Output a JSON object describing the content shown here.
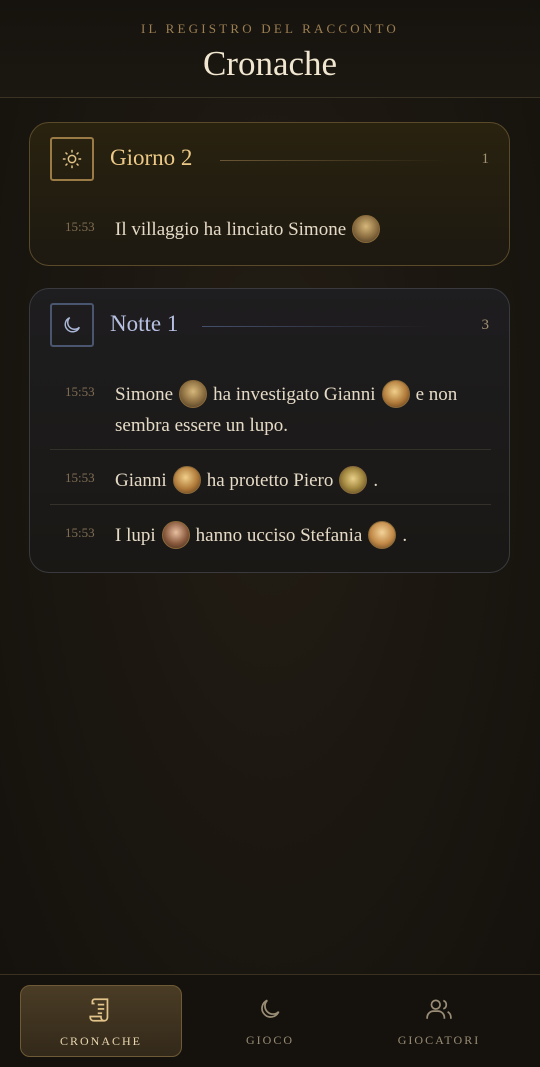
{
  "header": {
    "subtitle": "IL REGISTRO DEL RACCONTO",
    "title": "Cronache"
  },
  "phases": [
    {
      "title": "Giorno 2",
      "count": "1",
      "icon": "sun-icon",
      "entries": [
        {
          "time": "15:53",
          "parts": [
            "Il villaggio ha linciato Simone",
            ""
          ]
        }
      ]
    },
    {
      "title": "Notte 1",
      "count": "3",
      "icon": "moon-icon",
      "entries": [
        {
          "time": "15:53",
          "parts": [
            "Simone",
            "ha investigato Gianni",
            "e non sembra essere un lupo."
          ]
        },
        {
          "time": "15:53",
          "parts": [
            "Gianni",
            "ha protetto Piero",
            "."
          ]
        },
        {
          "time": "15:53",
          "parts": [
            "I lupi",
            "hanno ucciso Stefania",
            "."
          ]
        }
      ]
    }
  ],
  "nav": {
    "tabs": [
      {
        "label": "CRONACHE",
        "icon": "scroll-icon",
        "active": true
      },
      {
        "label": "GIOCO",
        "icon": "moon-icon",
        "active": false
      },
      {
        "label": "GIOCATORI",
        "icon": "users-icon",
        "active": false
      }
    ]
  },
  "colors": {
    "accent": "#ecc987",
    "night_accent": "#b7c0e3",
    "background": "#1a1610"
  }
}
